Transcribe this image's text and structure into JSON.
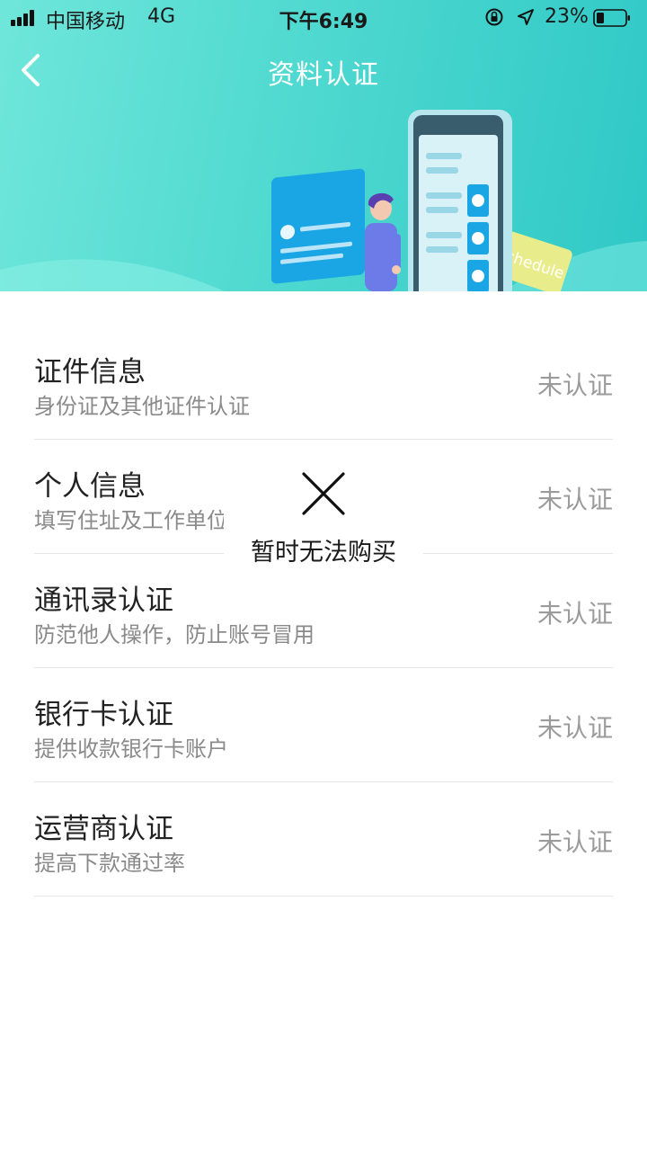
{
  "status_bar": {
    "carrier": "中国移动",
    "network": "4G",
    "time": "下午6:49",
    "battery_percent": "23%",
    "signal_icon": "signal-bars-icon",
    "lock_icon": "rotation-lock-icon",
    "location_icon": "location-arrow-icon",
    "battery_icon": "battery-icon"
  },
  "header": {
    "title": "资料认证",
    "back_icon": "chevron-left-icon",
    "banner_color_start": "#6fe6da",
    "banner_color_end": "#2fc8c6",
    "illustration_sign_text": "chedule"
  },
  "verification_items": [
    {
      "title": "证件信息",
      "description": "身份证及其他证件认证",
      "status": "未认证"
    },
    {
      "title": "个人信息",
      "description": "填写住址及工作单位",
      "status": "未认证"
    },
    {
      "title": "通讯录认证",
      "description": "防范他人操作，防止账号冒用",
      "status": "未认证"
    },
    {
      "title": "银行卡认证",
      "description": "提供收款银行卡账户",
      "status": "未认证"
    },
    {
      "title": "运营商认证",
      "description": "提高下款通过率",
      "status": "未认证"
    }
  ],
  "toast": {
    "icon": "close-x-icon",
    "message": "暂时无法购买"
  }
}
